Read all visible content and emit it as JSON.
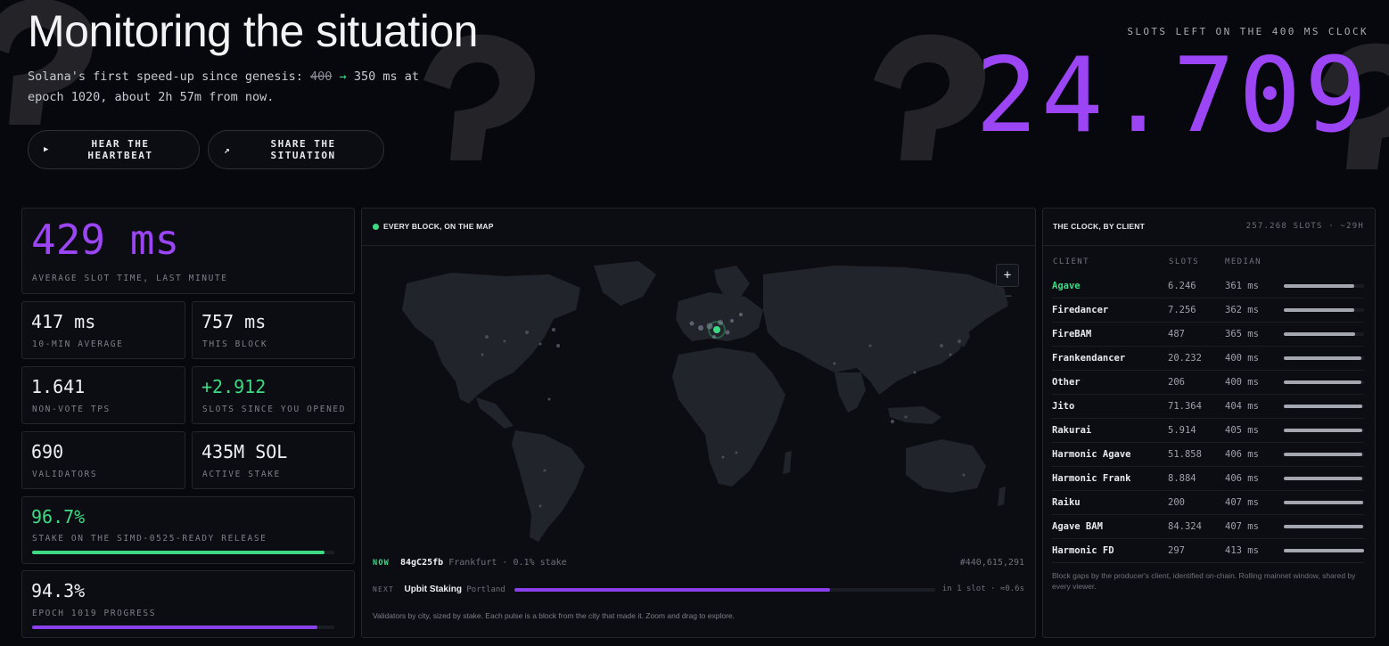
{
  "hero": {
    "title": "Monitoring the situation",
    "sub_prefix": "Solana's first speed-up since genesis:",
    "sub_old": "400",
    "sub_arrow": "→",
    "sub_rest": "350 ms at epoch 1020, about 2h 57m from now."
  },
  "buttons": {
    "heartbeat_icon": "▶",
    "heartbeat": "HEAR THE HEARTBEAT",
    "share_icon": "↗",
    "share": "SHARE THE SITUATION"
  },
  "clock": {
    "label": "SLOTS LEFT ON THE 400 MS CLOCK",
    "value": "24.709"
  },
  "stats": {
    "avg_slot": {
      "value": "429 ms",
      "label": "AVERAGE SLOT TIME, LAST MINUTE"
    },
    "ten_min": {
      "value": "417 ms",
      "label": "10-MIN AVERAGE"
    },
    "this_block": {
      "value": "757 ms",
      "label": "THIS BLOCK"
    },
    "tps": {
      "value": "1.641",
      "label": "NON-VOTE TPS"
    },
    "slots_since": {
      "value": "+2.912",
      "label": "SLOTS SINCE YOU OPENED"
    },
    "validators": {
      "value": "690",
      "label": "VALIDATORS"
    },
    "active_stake": {
      "value": "435M SOL",
      "label": "ACTIVE STAKE"
    },
    "simd": {
      "value": "96.7%",
      "label": "STAKE ON THE SIMD-0525-READY RELEASE",
      "progress": 0.967
    },
    "epoch": {
      "value": "94.3%",
      "label": "EPOCH 1019 PROGRESS",
      "progress": 0.943
    }
  },
  "map": {
    "title": "EVERY BLOCK, ON THE MAP",
    "zoom_in": "+",
    "zoom_out": "−",
    "now_tag": "NOW",
    "now_hash": "84gC25fb",
    "now_city": "Frankfurt",
    "now_sep": "·",
    "now_stake": "0.1% stake",
    "now_slot": "#440,615,291",
    "next_tag": "NEXT",
    "next_name": "Upbit Staking",
    "next_city": "Portland",
    "next_eta": "in 1 slot · ≈0.6s",
    "next_progress": 0.75,
    "footer": "Validators by city, sized by stake. Each pulse is a block from the city that made it. Zoom and drag to explore."
  },
  "clients": {
    "title": "THE CLOCK, BY CLIENT",
    "summary": "257.268 SLOTS · ~29H",
    "headers": {
      "client": "CLIENT",
      "slots": "SLOTS",
      "median": "MEDIAN"
    },
    "rows": [
      {
        "name": "Agave",
        "slots": "6.246",
        "median": "361 ms",
        "median_ms": 361,
        "highlight": true
      },
      {
        "name": "Firedancer",
        "slots": "7.256",
        "median": "362 ms",
        "median_ms": 362
      },
      {
        "name": "FireBAM",
        "slots": "487",
        "median": "365 ms",
        "median_ms": 365
      },
      {
        "name": "Frankendancer",
        "slots": "20.232",
        "median": "400 ms",
        "median_ms": 400
      },
      {
        "name": "Other",
        "slots": "206",
        "median": "400 ms",
        "median_ms": 400
      },
      {
        "name": "Jito",
        "slots": "71.364",
        "median": "404 ms",
        "median_ms": 404
      },
      {
        "name": "Rakurai",
        "slots": "5.914",
        "median": "405 ms",
        "median_ms": 405
      },
      {
        "name": "Harmonic Agave",
        "slots": "51.858",
        "median": "406 ms",
        "median_ms": 406
      },
      {
        "name": "Harmonic Frank",
        "slots": "8.884",
        "median": "406 ms",
        "median_ms": 406
      },
      {
        "name": "Raiku",
        "slots": "200",
        "median": "407 ms",
        "median_ms": 407
      },
      {
        "name": "Agave BAM",
        "slots": "84.324",
        "median": "407 ms",
        "median_ms": 407
      },
      {
        "name": "Harmonic FD",
        "slots": "297",
        "median": "413 ms",
        "median_ms": 413
      }
    ],
    "footer": "Block gaps by the producer's client, identified on-chain. Rolling mainnet window, shared by every viewer."
  },
  "colors": {
    "accent_purple": "#9b45f5",
    "accent_green": "#3ddc84"
  }
}
